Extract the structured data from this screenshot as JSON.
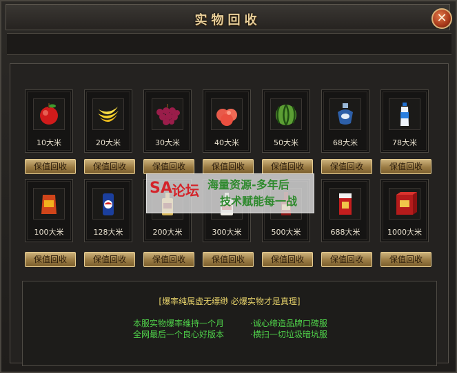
{
  "window": {
    "title": "实物回收",
    "close_glyph": "✕"
  },
  "accent": {
    "button_gold": "#b8985a",
    "text_yellow": "#e8d36b",
    "text_green": "#4fd14a"
  },
  "items_row1": [
    {
      "icon": "apple-icon",
      "price": "10大米",
      "button": "保值回收"
    },
    {
      "icon": "banana-icon",
      "price": "20大米",
      "button": "保值回收"
    },
    {
      "icon": "grapes-icon",
      "price": "30大米",
      "button": "保值回收"
    },
    {
      "icon": "peach-icon",
      "price": "40大米",
      "button": "保值回收"
    },
    {
      "icon": "watermelon-icon",
      "price": "50大米",
      "button": "保值回收"
    },
    {
      "icon": "perfume-icon",
      "price": "68大米",
      "button": "保值回收"
    },
    {
      "icon": "drink-bottle-icon",
      "price": "78大米",
      "button": "保值回收"
    }
  ],
  "items_row2": [
    {
      "icon": "snack-bag-icon",
      "price": "100大米",
      "button": "保值回收"
    },
    {
      "icon": "soda-can-icon",
      "price": "128大米",
      "button": "保值回收"
    },
    {
      "icon": "bottle-icon",
      "price": "200大米",
      "button": "保值回收"
    },
    {
      "icon": "liquor-bottle-icon",
      "price": "300大米",
      "button": "保值回收"
    },
    {
      "icon": "wine-bottle-icon",
      "price": "500大米",
      "button": "保值回收"
    },
    {
      "icon": "cigarette-pack-icon",
      "price": "688大米",
      "button": "保值回收"
    },
    {
      "icon": "cigarette-carton-icon",
      "price": "1000大米",
      "button": "保值回收"
    }
  ],
  "footer": {
    "headline": "[爆率纯属虚无缥缈 必爆实物才是真理]",
    "left_lines": [
      "本服实物爆率维持一个月",
      "全网最后一个良心好版本"
    ],
    "right_lines": [
      "·诚心缔造品牌口碑服",
      "·横扫一切垃圾暗坑服"
    ]
  },
  "watermark": {
    "logo": "SA",
    "logo_text": "论坛",
    "line1": "海量资源-多年后",
    "line2": "技术赋能每一战"
  }
}
